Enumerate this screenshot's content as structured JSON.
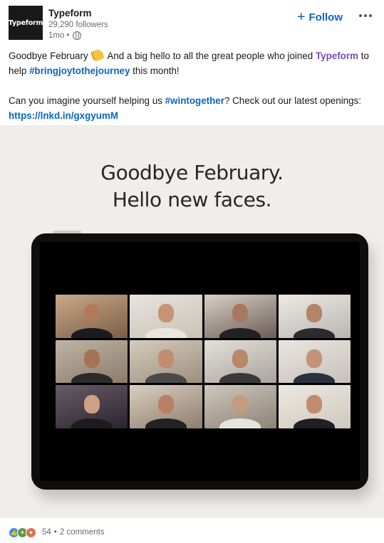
{
  "header": {
    "logo_text": "Typeform",
    "company": "Typeform",
    "followers": "29,290 followers",
    "time": "1mo",
    "visibility_icon": "globe-icon",
    "follow_label": "Follow",
    "more_icon": "ellipsis-icon"
  },
  "text": {
    "line1_prefix": "Goodbye February",
    "line1_mid": "And a big hello to all the great people who joined",
    "company_link": "Typeform",
    "line2_prefix": "to help",
    "hashtag1": "#bringjoytothejourney",
    "line2_suffix": "this month!",
    "line3_prefix": "Can you imagine yourself helping us",
    "hashtag2": "#wintogether",
    "line3_suffix": "? Check out our latest openings:",
    "url": "https://lnkd.in/gxgyumM"
  },
  "image": {
    "headline_line1": "Goodbye February.",
    "headline_line2": "Hello new faces."
  },
  "footer": {
    "reaction_icons": [
      "like-icon",
      "celebrate-icon",
      "love-icon"
    ],
    "reaction_count": "54",
    "comments": "2 comments"
  },
  "colors": {
    "brand_blue": "#0a66c2",
    "company_purple": "#7a4ab5",
    "image_bg": "#f0edea"
  }
}
